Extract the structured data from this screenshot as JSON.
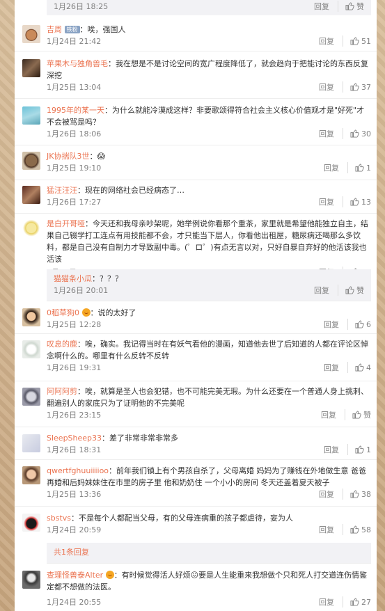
{
  "top_sub": {
    "time": "1月26日 18:25",
    "reply": "回复",
    "like": "赞"
  },
  "comments": [
    {
      "user": "吉周",
      "badge": "铁粉",
      "text": "：唉，强国人",
      "time": "1月24日 21:42",
      "reply": "回复",
      "likes": "51"
    },
    {
      "user": "苹果木与独角兽毛",
      "text": "：我在想是不是讨论空间的宽广程度降低了，就会趋向于把能讨论的东西反复深挖",
      "time": "1月25日 13:04",
      "reply": "回复",
      "likes": "37"
    },
    {
      "user": "1995年的某一天",
      "text": "：为什么就能冷漠成这样？非要歌颂得符合社会主义核心价值观才是\"好死\"才不会被骂是吗？",
      "time": "1月26日 18:06",
      "reply": "回复",
      "likes": "30"
    },
    {
      "user": "JK协揣队3世",
      "text": "：😱",
      "time": "1月25日 19:10",
      "reply": "回复",
      "likes": "1"
    },
    {
      "user": "猛汪汪汪",
      "text": "：现在的网络社会已经病态了…",
      "time": "1月26日 17:27",
      "reply": "回复",
      "likes": "13"
    },
    {
      "user": "是白开哥哑",
      "text": "：今天还和我母亲吵架呢，她举例说你看那个重茶，家里就是希望他能独立自主，结果自己辍学打工连点有用技能都不会，才只能当下层人，你看他出租屋，糖尿病还喝那么多饮料，都是自己没有自制力才导致副中毒。(゜ロ゜)有点无言以对，只好自暴自弃好的他活该我也活该",
      "time": "1月26日 18:55",
      "reply": "回复",
      "likes": "10"
    },
    {
      "user": "0稻草狗0",
      "text": "：说的太好了",
      "time": "1月25日 12:28",
      "reply": "回复",
      "likes": "6"
    },
    {
      "user": "叹息的鹿",
      "text": "：唉，确实。我记得当时在有妖气看他的漫画，知道他去世了后知道的人都在评论区悼念啊什么的。哪里有什么反转不反转",
      "time": "1月26日 19:31",
      "reply": "回复",
      "likes": "4"
    },
    {
      "user": "阿阿阿剪",
      "text": "：唉，就算是圣人也会犯错，也不可能完美无瑕。为什么还要在一个普通人身上挑刺、翻遍别人的家底只为了证明他的不完美呢",
      "time": "1月26日 23:15",
      "reply": "回复",
      "likes": "赞"
    },
    {
      "user": "SleepSheep33",
      "text": "：差了非常非常非常多",
      "time": "1月26日 18:31",
      "reply": "回复",
      "likes": "1"
    },
    {
      "user": "qwertfghuuiiiioo",
      "text": "：前年我们镇上有个男孩自杀了，父母离婚 妈妈为了赚钱在外地做生意 爸爸再婚和后妈妹妹住在市里的房子里 他和奶奶住 一个小小的房间 冬天还盖着夏天被子",
      "time": "1月25日 13:36",
      "reply": "回复",
      "likes": "38"
    },
    {
      "user": "sbstvs",
      "text": "：不是每个人都配当父母，有的父母连病重的孩子都虐待，妄为人",
      "time": "1月24日 20:59",
      "reply": "回复",
      "likes": "58"
    },
    {
      "user": "查理怪兽泰Alter",
      "text": "：有时候觉得活人好烦😖要是人生能重来我想做个只和死人打交道连伤情鉴定都不想做的法医。",
      "time": "1月24日 20:55",
      "reply": "回复",
      "likes": "27"
    }
  ],
  "sub_reply": {
    "user": "猫猫条小瓜",
    "text": "：？？？",
    "time": "1月26日 20:01",
    "reply": "回复",
    "like": "赞"
  },
  "more_replies": "共1条回复",
  "colors": {
    "username": "#eb7350",
    "subbg": "#f2f2f5",
    "time": "#808080"
  }
}
